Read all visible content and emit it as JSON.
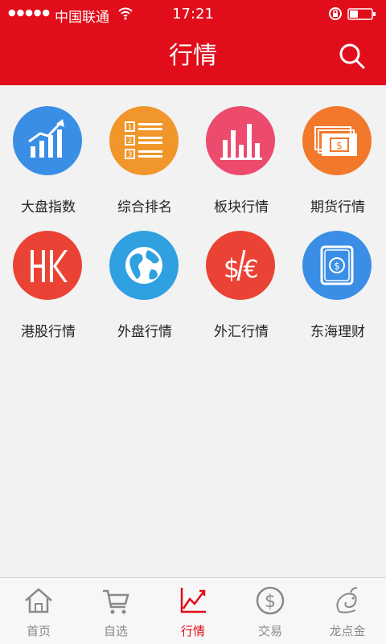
{
  "status_bar": {
    "signal": "●●●●●",
    "carrier": "中国联通",
    "time": "17:21"
  },
  "header": {
    "title": "行情"
  },
  "colors": {
    "brand_red": "#e10d1a",
    "blue": "#3a8ee6",
    "orange": "#f0962a",
    "pink": "#ec4b6e",
    "orange_red": "#f2792b",
    "red": "#ea4335"
  },
  "grid": [
    {
      "label": "大盘指数",
      "icon": "chart-up-icon"
    },
    {
      "label": "综合排名",
      "icon": "ranking-list-icon"
    },
    {
      "label": "板块行情",
      "icon": "bar-chart-icon"
    },
    {
      "label": "期货行情",
      "icon": "money-bills-icon"
    },
    {
      "label": "港股行情",
      "icon": "hk-text-icon"
    },
    {
      "label": "外盘行情",
      "icon": "globe-icon"
    },
    {
      "label": "外汇行情",
      "icon": "dollar-euro-icon"
    },
    {
      "label": "东海理财",
      "icon": "wallet-coin-icon"
    }
  ],
  "tabs": [
    {
      "label": "首页",
      "icon": "home-icon"
    },
    {
      "label": "自选",
      "icon": "cart-icon"
    },
    {
      "label": "行情",
      "icon": "trend-icon",
      "active": true
    },
    {
      "label": "交易",
      "icon": "dollar-circle-icon"
    },
    {
      "label": "龙点金",
      "icon": "dragon-icon"
    }
  ]
}
